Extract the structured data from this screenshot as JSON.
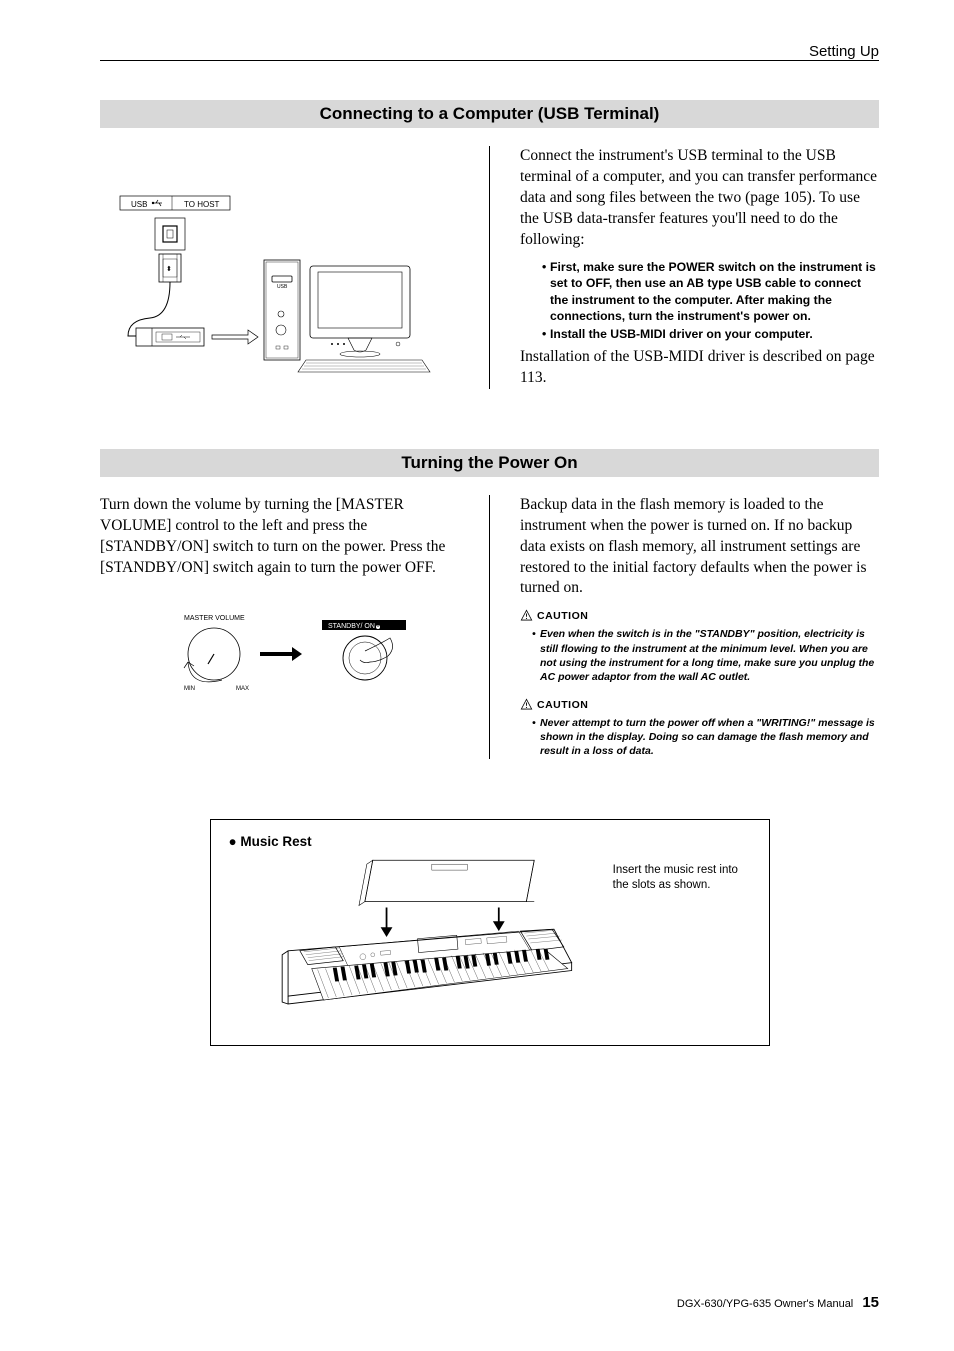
{
  "chapter": "Setting Up",
  "section1": {
    "title": "Connecting to a Computer (USB Terminal)",
    "intro": "Connect the instrument's USB terminal to the USB terminal of a computer, and you can transfer performance data and song files between the two (page 105). To use the USB data-transfer features you'll need to do the following:",
    "bullets": [
      "First, make sure the POWER switch on the instrument is set to OFF, then use an AB type USB cable to connect the instrument to the computer. After making the connections, turn the instrument's power on.",
      "Install the USB-MIDI driver on your computer."
    ],
    "after": "Installation of the USB-MIDI driver is described on page 113.",
    "fig": {
      "usb_label": "USB",
      "to_host": "TO HOST",
      "port_label": "USB"
    }
  },
  "section2": {
    "title": "Turning the Power On",
    "left": "Turn down the volume by turning the [MASTER VOLUME] control to the left and press the [STANDBY/ON] switch to turn on the power. Press the [STANDBY/ON] switch again to turn the power OFF.",
    "right_intro": "Backup data in the flash memory is loaded to the instrument when the power is turned on. If no backup data exists on flash memory, all instrument settings are restored to the initial factory defaults when the power is turned on.",
    "caution_label": "CAUTION",
    "caution1": "Even when the switch is in the \"STANDBY\" position, electricity is still flowing to the instrument at the minimum level. When you are not using the instrument for a long time, make sure you unplug the AC power adaptor from the wall AC outlet.",
    "caution2": "Never attempt to turn the power off when a \"WRITING!\" message is shown in the display. Doing so can damage the flash memory and result in a loss of data.",
    "fig": {
      "master_volume": "MASTER VOLUME",
      "min": "MIN",
      "max": "MAX",
      "standby": "STANDBY/     ON"
    }
  },
  "music_rest": {
    "title": "● Music Rest",
    "note": "Insert the music rest into the slots as shown."
  },
  "footer": {
    "manual": "DGX-630/YPG-635  Owner's Manual",
    "page": "15"
  }
}
